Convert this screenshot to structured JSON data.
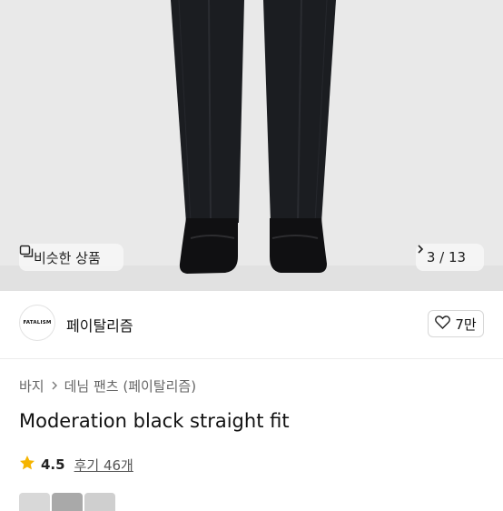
{
  "hero": {
    "similar_label": "비슷한 상품",
    "counter": "3 / 13"
  },
  "brand": {
    "logo_text": "FATALISM",
    "name": "페이탈리즘",
    "likes": "7만"
  },
  "breadcrumb": {
    "level1": "바지",
    "level2": "데님 팬츠 (페이탈리즘)"
  },
  "product": {
    "title": "Moderation black straight fit"
  },
  "rating": {
    "score": "4.5",
    "reviews": "후기 46개"
  },
  "colors": {
    "star": "#f5b400",
    "hero_bg": "#e8e8e8"
  }
}
